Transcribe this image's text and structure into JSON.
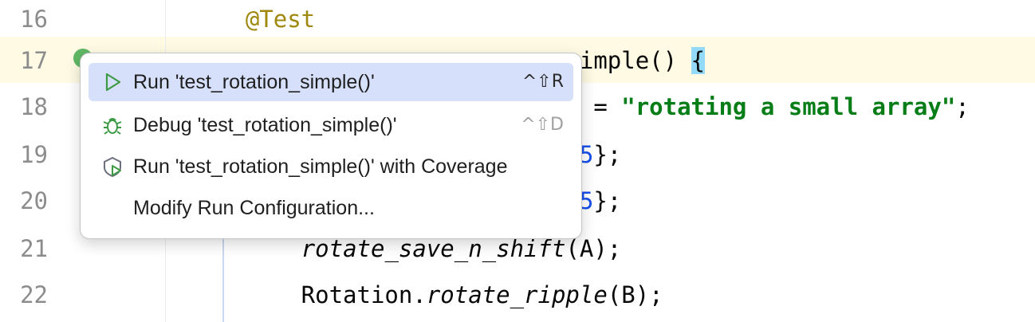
{
  "editor": {
    "lines": [
      {
        "num": "16",
        "parts": [
          {
            "text": "    "
          },
          {
            "text": "@Test",
            "cls": "ann"
          }
        ]
      },
      {
        "num": "17",
        "parts": [
          {
            "text": "                          _simple() "
          },
          {
            "text": "{",
            "cls": "brace-hl"
          }
        ]
      },
      {
        "num": "18",
        "parts": [
          {
            "text": "                          on = "
          },
          {
            "text": "\"rotating a small array\"",
            "cls": "str"
          },
          {
            "text": ";"
          }
        ]
      },
      {
        "num": "19",
        "parts": [
          {
            "text": "                          , "
          },
          {
            "text": "5",
            "cls": "num"
          },
          {
            "text": "};"
          }
        ]
      },
      {
        "num": "20",
        "parts": [
          {
            "text": "                          , "
          },
          {
            "text": "5",
            "cls": "num"
          },
          {
            "text": "};"
          }
        ]
      },
      {
        "num": "21",
        "parts": [
          {
            "text": "        "
          },
          {
            "text": "rotate_save_n_shift",
            "cls": "it"
          },
          {
            "text": "(A);"
          }
        ]
      },
      {
        "num": "22",
        "parts": [
          {
            "text": "        Rotation."
          },
          {
            "text": "rotate_ripple",
            "cls": "it"
          },
          {
            "text": "(B);"
          }
        ]
      }
    ]
  },
  "popup": {
    "items": [
      {
        "label": "Run 'test_rotation_simple()'",
        "shortcut": "^⇧R",
        "icon": "run-icon",
        "selected": true
      },
      {
        "label": "Debug 'test_rotation_simple()'",
        "shortcut": "^⇧D",
        "icon": "debug-icon",
        "selected": false
      },
      {
        "label": "Run 'test_rotation_simple()' with Coverage",
        "shortcut": "",
        "icon": "coverage-icon",
        "selected": false
      },
      {
        "label": "Modify Run Configuration...",
        "shortcut": "",
        "icon": "",
        "selected": false
      }
    ]
  },
  "colors": {
    "accent_run": "#5fb865",
    "selection": "#d6e0fb",
    "current_line": "#fefae3"
  }
}
